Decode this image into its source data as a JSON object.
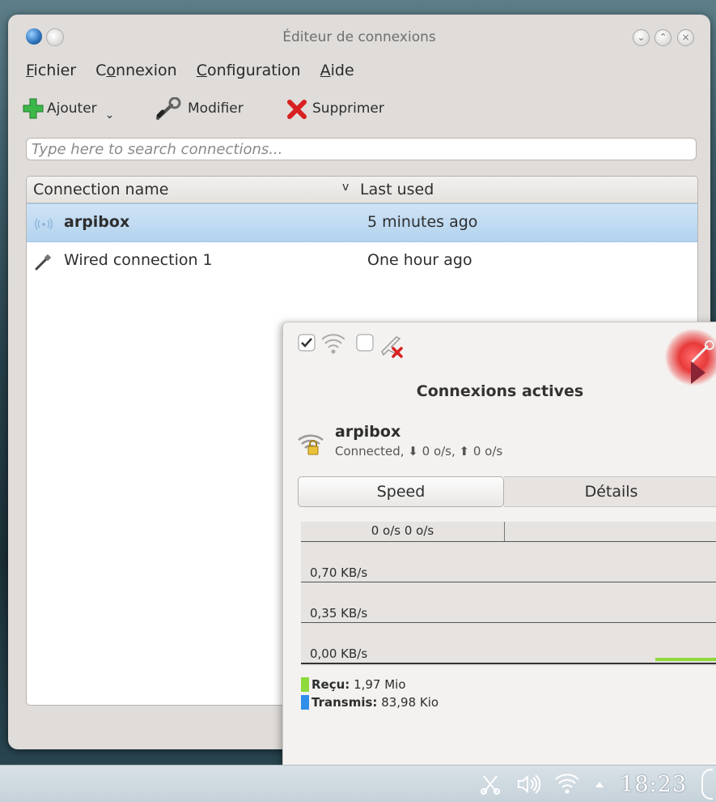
{
  "window": {
    "title": "Éditeur de connexions",
    "menu": [
      {
        "pre": "",
        "mnemonic": "F",
        "post": "ichier"
      },
      {
        "pre": "C",
        "mnemonic": "o",
        "post": "nnexion"
      },
      {
        "pre": "",
        "mnemonic": "C",
        "post": "onfiguration"
      },
      {
        "pre": "",
        "mnemonic": "A",
        "post": "ide"
      }
    ],
    "toolbar": {
      "add_label": "Ajouter",
      "edit_label": "Modifier",
      "delete_label": "Supprimer"
    },
    "search": {
      "placeholder": "Type here to search connections..."
    },
    "list": {
      "columns": [
        "Connection name",
        "Last used"
      ],
      "sort_indicator": "v",
      "rows": [
        {
          "icon": "wireless-icon",
          "name": "arpibox",
          "last_used": "5 minutes ago",
          "selected": true
        },
        {
          "icon": "wired-cable-icon",
          "name": "Wired connection 1",
          "last_used": "One hour ago",
          "selected": false
        }
      ]
    }
  },
  "popup": {
    "title": "Connexions actives",
    "connection": {
      "name": "arpibox",
      "status": "Connected, ⬇ 0 o/s, ⬆ 0 o/s"
    },
    "tabs": [
      "Speed",
      "Détails"
    ],
    "graph": {
      "header": "0 o/s 0 o/s",
      "labels": [
        "0,70 KB/s",
        "0,35 KB/s",
        "0,00 KB/s"
      ]
    },
    "legend": [
      {
        "label": "Reçu:",
        "value": "1,97 Mio",
        "color": "#8fd93b"
      },
      {
        "label": "Transmis:",
        "value": "83,98 Kio",
        "color": "#2f8fe8"
      }
    ]
  },
  "taskbar": {
    "clock": "18:23"
  }
}
